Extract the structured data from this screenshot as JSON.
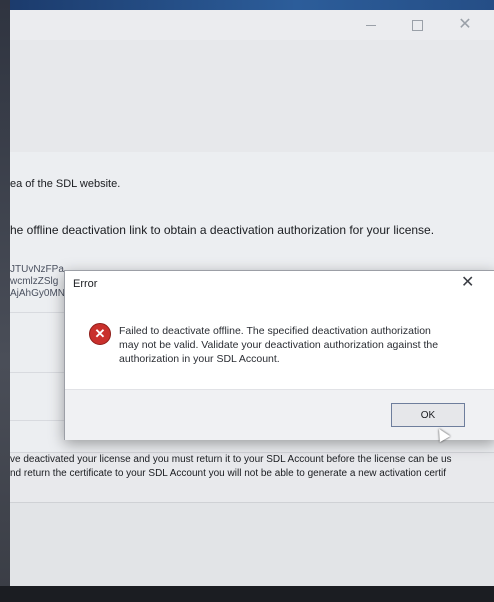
{
  "window": {
    "minimize_symbol": "—",
    "maximize_symbol": "☐",
    "close_symbol": "✕"
  },
  "content": {
    "line1": "ea of the SDL website.",
    "line2": "he offline deactivation link to obtain a deactivation authorization for your license.",
    "code_lines": [
      "JTUvNzFPa",
      "wcmlzZSlg",
      "AjAhGy0MN"
    ],
    "bottom_line1": "ve deactivated your license and you must return it to your SDL Account before the license can be us",
    "bottom_line2": "nd return the certificate to your SDL Account you will not be able to generate a new activation certif"
  },
  "dialog": {
    "title": "Error",
    "close_symbol": "✕",
    "icon": "error-icon",
    "message_lines": [
      "Failed to deactivate offline. The specified deactivation authorization",
      "may not be valid. Validate your deactivation authorization against the",
      "authorization in your SDL Account."
    ],
    "ok_label": "OK"
  }
}
